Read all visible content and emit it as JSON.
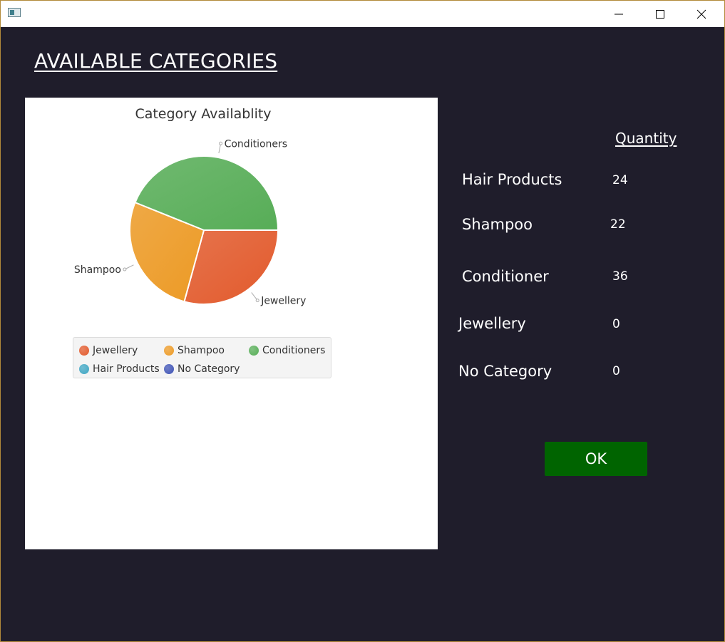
{
  "window": {
    "title": "",
    "app_icon": "app-icon",
    "controls": [
      "minimize-icon",
      "maximize-icon",
      "close-icon"
    ]
  },
  "page_title": "AVAILABLE CATEGORIES",
  "chart_data": {
    "type": "pie",
    "title": "Category Availablity",
    "categories": [
      "Jewellery",
      "Shampoo",
      "Conditioners",
      "Hair Products",
      "No Category"
    ],
    "values": [
      24,
      22,
      36,
      0,
      0
    ],
    "colors": [
      "#e25a2c",
      "#ec9a25",
      "#57ad57",
      "#3fa6c3",
      "#3f53b5"
    ],
    "slice_labels": [
      "Jewellery",
      "Shampoo",
      "Conditioners",
      "Hair Products"
    ],
    "legend": {
      "placement": "bottom",
      "items": [
        "Jewellery",
        "Shampoo",
        "Conditioners",
        "Hair Products",
        "No Category"
      ]
    }
  },
  "quantity": {
    "header": "Quantity",
    "rows": [
      {
        "label": "Hair Products",
        "value": "24"
      },
      {
        "label": "Shampoo",
        "value": "22"
      },
      {
        "label": "Conditioner",
        "value": "36"
      },
      {
        "label": "Jewellery",
        "value": "0"
      },
      {
        "label": "No Category",
        "value": "0"
      }
    ]
  },
  "ok_button": {
    "label": "OK",
    "color": "#006400"
  },
  "colors": {
    "background": "#1f1d2b",
    "text": "#ffffff"
  }
}
